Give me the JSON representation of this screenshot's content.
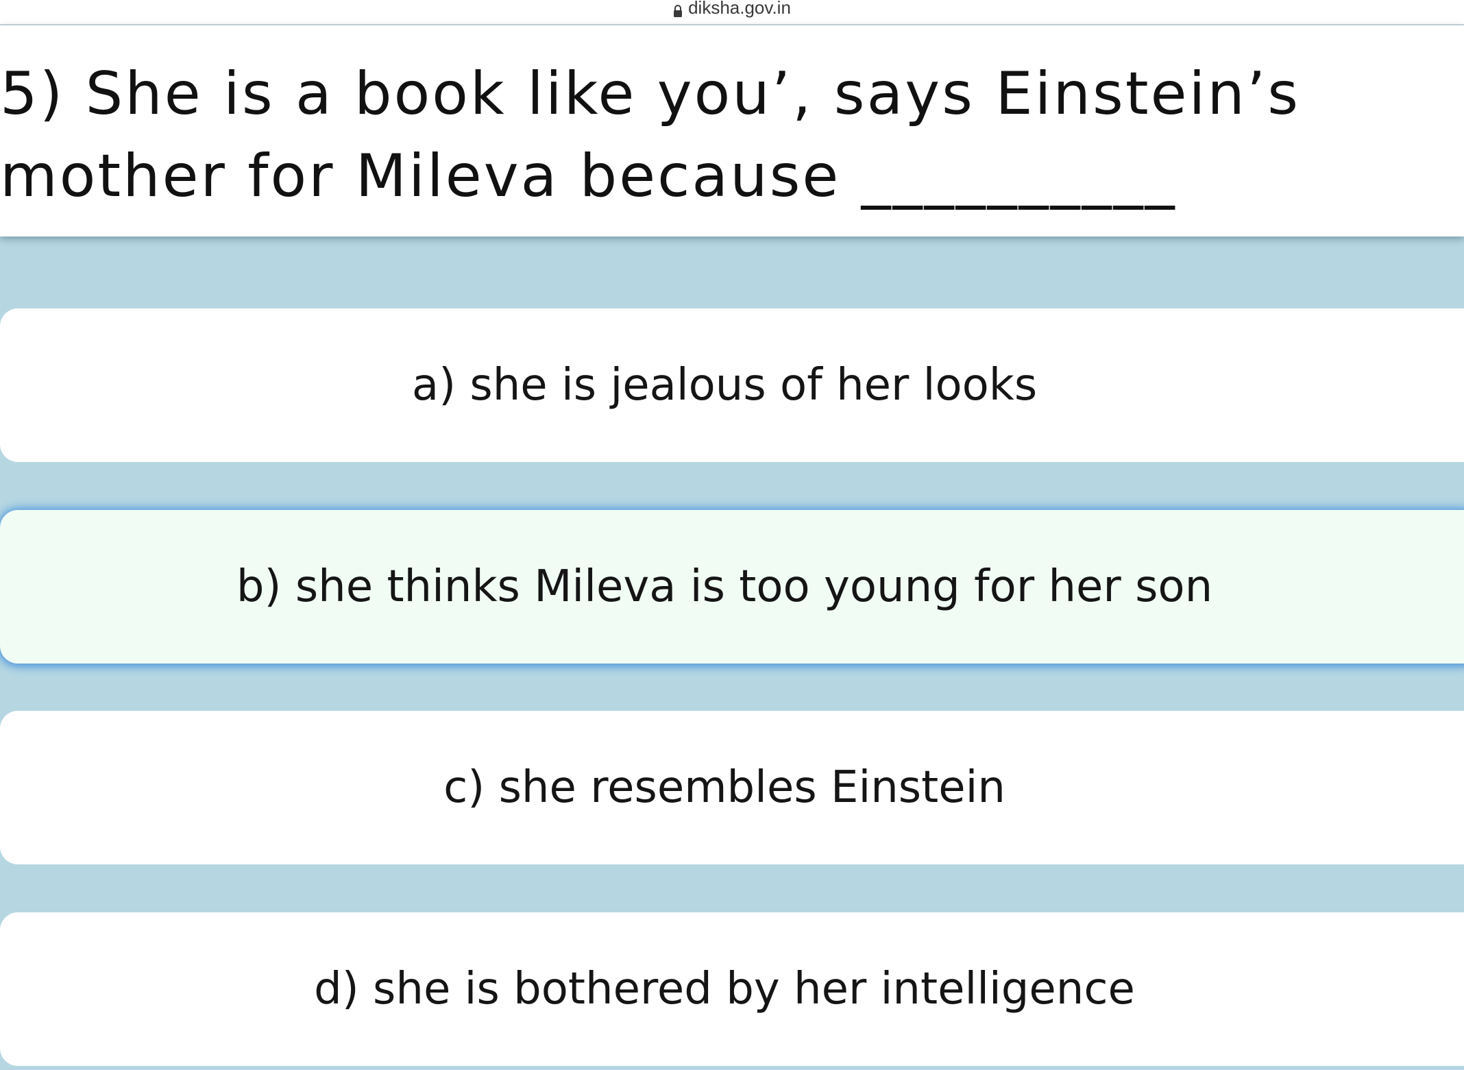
{
  "browser": {
    "url": "diksha.gov.in",
    "lock_icon": "lock-icon"
  },
  "quiz": {
    "question": "5) She is a book like you’, says Einstein’s mother for Mileva because __________",
    "options": [
      {
        "label": "a) she is jealous of her looks",
        "selected": false
      },
      {
        "label": "b) she thinks Mileva is too young for her son",
        "selected": true
      },
      {
        "label": "c) she resembles Einstein",
        "selected": false
      },
      {
        "label": "d) she is bothered by her intelligence",
        "selected": false
      }
    ]
  },
  "colors": {
    "background": "#b6d7e2",
    "option_background": "#ffffff",
    "selected_background": "#f1fcf5",
    "selected_glow": "#3c8cdc"
  }
}
